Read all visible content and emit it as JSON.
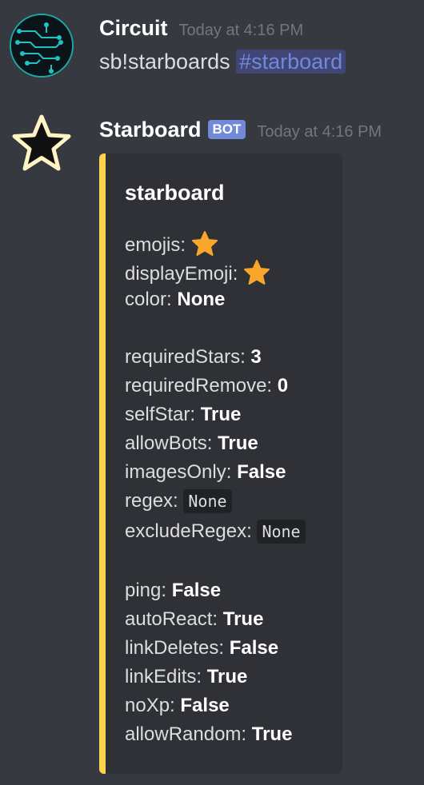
{
  "messages": [
    {
      "author": "Circuit",
      "timestamp": "Today at 4:16 PM",
      "avatar_icon": "circuit-board-icon",
      "content_text": "sb!starboards",
      "channel_mention": "#starboard"
    },
    {
      "author": "Starboard",
      "bot_label": "BOT",
      "timestamp": "Today at 4:16 PM",
      "avatar_icon": "star-outline-icon",
      "embed": {
        "accent_color": "#fcd34d",
        "title": "starboard",
        "fields": {
          "emojis_label": "emojis:",
          "emojis_icon": "star-emoji",
          "displayEmoji_label": "displayEmoji:",
          "displayEmoji_icon": "star-emoji",
          "color_label": "color:",
          "color_value": "None",
          "requiredStars_label": "requiredStars:",
          "requiredStars_value": "3",
          "requiredRemove_label": "requiredRemove:",
          "requiredRemove_value": "0",
          "selfStar_label": "selfStar:",
          "selfStar_value": "True",
          "allowBots_label": "allowBots:",
          "allowBots_value": "True",
          "imagesOnly_label": "imagesOnly:",
          "imagesOnly_value": "False",
          "regex_label": "regex:",
          "regex_value": "None",
          "excludeRegex_label": "excludeRegex:",
          "excludeRegex_value": "None",
          "ping_label": "ping:",
          "ping_value": "False",
          "autoReact_label": "autoReact:",
          "autoReact_value": "True",
          "linkDeletes_label": "linkDeletes:",
          "linkDeletes_value": "False",
          "linkEdits_label": "linkEdits:",
          "linkEdits_value": "True",
          "noXp_label": "noXp:",
          "noXp_value": "False",
          "allowRandom_label": "allowRandom:",
          "allowRandom_value": "True"
        }
      }
    }
  ],
  "colors": {
    "background": "#36393f",
    "embed_background": "#2f3136",
    "bot_tag": "#7289da",
    "mention": "#7289da",
    "star_emoji": "#f9a62b"
  }
}
